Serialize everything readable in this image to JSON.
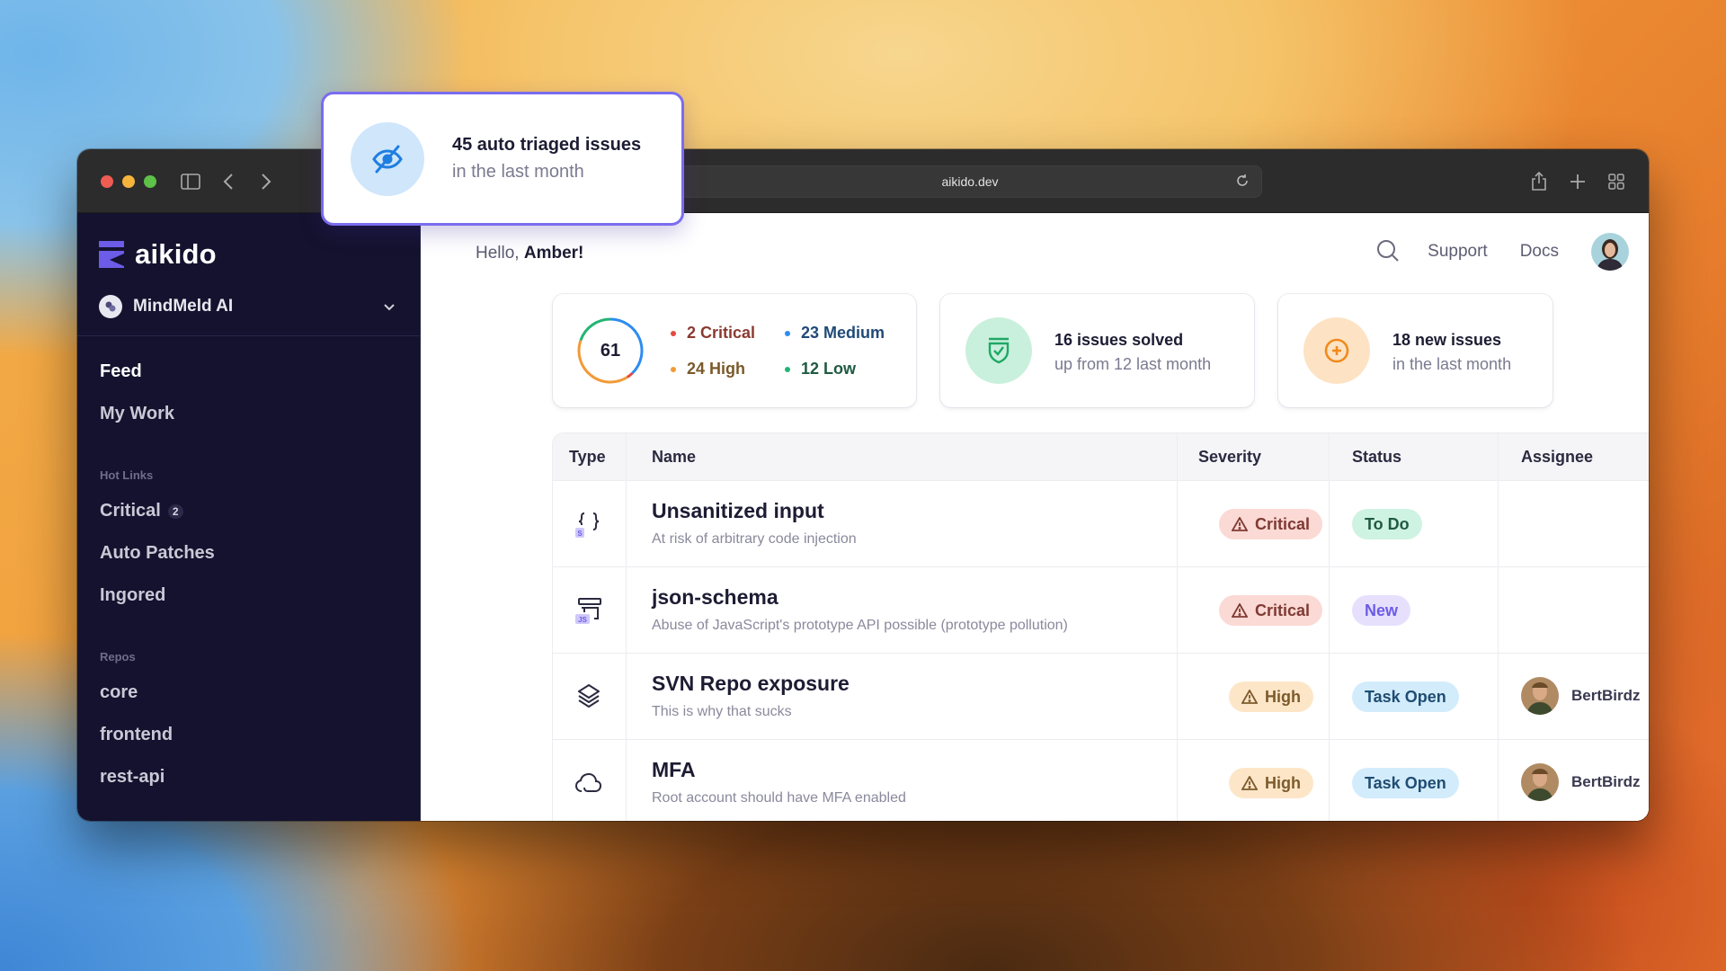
{
  "browser": {
    "url": "aikido.dev"
  },
  "popup": {
    "title": "45 auto triaged issues",
    "subtitle": "in the last month",
    "icon": "eye-off-icon"
  },
  "sidebar": {
    "brand": "aikido",
    "workspace": "MindMeld AI",
    "items": [
      {
        "label": "Feed"
      },
      {
        "label": "My Work"
      }
    ],
    "hot_links_label": "Hot Links",
    "hot_links": [
      {
        "label": "Critical",
        "badge": "2"
      },
      {
        "label": "Auto Patches"
      },
      {
        "label": "Ingored"
      }
    ],
    "repos_label": "Repos",
    "repos": [
      {
        "label": "core"
      },
      {
        "label": "frontend"
      },
      {
        "label": "rest-api"
      }
    ]
  },
  "header": {
    "greeting_prefix": "Hello, ",
    "greeting_name": "Amber!",
    "support": "Support",
    "docs": "Docs"
  },
  "summary": {
    "total": "61",
    "critical": {
      "count": 2,
      "label": "2 Critical",
      "color": "#e5493f"
    },
    "high": {
      "count": 24,
      "label": "24 High",
      "color": "#f29a36"
    },
    "medium": {
      "count": 23,
      "label": "23 Medium",
      "color": "#2d8cf0"
    },
    "low": {
      "count": 12,
      "label": "12 Low",
      "color": "#22b573"
    }
  },
  "cards": {
    "solved": {
      "title": "16 issues solved",
      "subtitle": "up from 12 last month"
    },
    "new": {
      "title": "18 new issues",
      "subtitle": "in the last month"
    }
  },
  "table": {
    "headers": [
      "Type",
      "Name",
      "Severity",
      "Status",
      "Assignee"
    ],
    "rows": [
      {
        "type": "code-icon",
        "name": "Unsanitized input",
        "description": "At risk of arbitrary code injection",
        "severity": "Critical",
        "status": "To Do",
        "assignee": ""
      },
      {
        "type": "dependency-icon",
        "name": "json-schema",
        "description": "Abuse of JavaScript's prototype API possible (prototype pollution)",
        "severity": "Critical",
        "status": "New",
        "assignee": ""
      },
      {
        "type": "layers-icon",
        "name": "SVN Repo exposure",
        "description": "This is why that sucks",
        "severity": "High",
        "status": "Task Open",
        "assignee": "BertBirdz"
      },
      {
        "type": "cloud-icon",
        "name": "MFA",
        "description": "Root account should have MFA enabled",
        "severity": "High",
        "status": "Task Open",
        "assignee": "BertBirdz"
      }
    ]
  },
  "colors": {
    "brand": "#6c5ce7",
    "sidebar_bg": "#14122e"
  }
}
